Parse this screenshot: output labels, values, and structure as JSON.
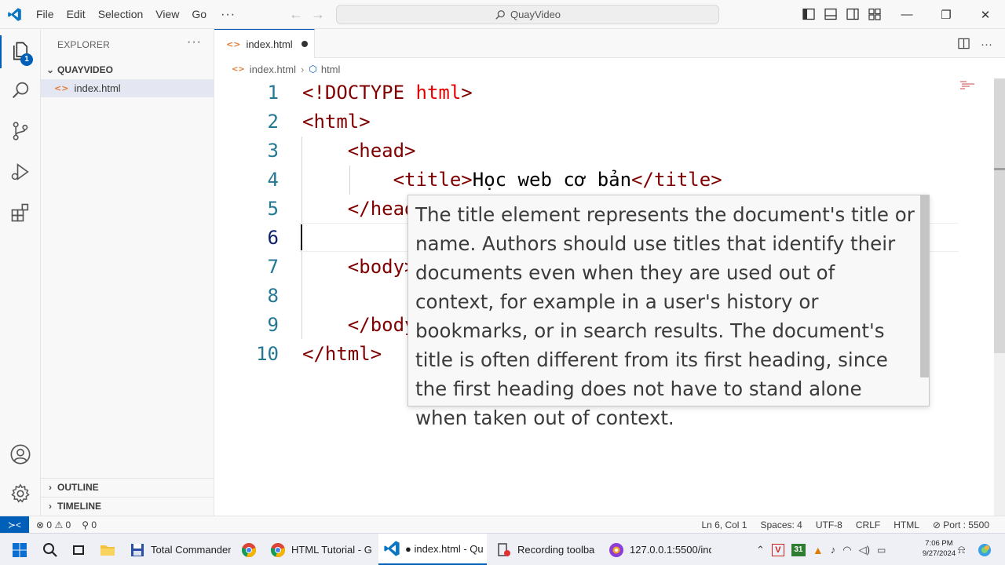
{
  "titlebar": {
    "menu": [
      "File",
      "Edit",
      "Selection",
      "View",
      "Go"
    ],
    "more": "···",
    "search": "QuayVideo",
    "window_controls": [
      "minimize-icon",
      "restore-icon",
      "close-icon"
    ]
  },
  "activity": {
    "explorer_badge": "1",
    "items": [
      "files-icon",
      "search-icon",
      "source-control-icon",
      "run-debug-icon",
      "extensions-icon",
      "account-icon",
      "settings-gear-icon"
    ]
  },
  "sidebar": {
    "title": "EXPLORER",
    "more": "···",
    "folder": "QUAYVIDEO",
    "file": "index.html",
    "outline": "OUTLINE",
    "timeline": "TIMELINE"
  },
  "tabs": [
    {
      "label": "index.html",
      "dirty": true
    }
  ],
  "breadcrumb": {
    "file": "index.html",
    "element": "html"
  },
  "editor": {
    "lines": [
      {
        "n": "1",
        "parts": [
          [
            "tag",
            "<!DOCTYPE "
          ],
          [
            "attr",
            "html"
          ],
          [
            "tag",
            ">"
          ]
        ]
      },
      {
        "n": "2",
        "parts": [
          [
            "tag",
            "<html>"
          ]
        ]
      },
      {
        "n": "3",
        "parts": [
          [
            "txt",
            "    "
          ],
          [
            "tag",
            "<head>"
          ]
        ]
      },
      {
        "n": "4",
        "parts": [
          [
            "txt",
            "        "
          ],
          [
            "tag",
            "<title>"
          ],
          [
            "txt",
            "Học web cơ bản"
          ],
          [
            "tag",
            "</title>"
          ]
        ]
      },
      {
        "n": "5",
        "parts": [
          [
            "txt",
            "    "
          ],
          [
            "tag",
            "</head>"
          ]
        ]
      },
      {
        "n": "6",
        "parts": []
      },
      {
        "n": "7",
        "parts": [
          [
            "txt",
            "    "
          ],
          [
            "tag",
            "<body>"
          ]
        ]
      },
      {
        "n": "8",
        "parts": []
      },
      {
        "n": "9",
        "parts": [
          [
            "txt",
            "    "
          ],
          [
            "tag",
            "</body>"
          ]
        ]
      },
      {
        "n": "10",
        "parts": [
          [
            "tag",
            "</html>"
          ]
        ]
      }
    ],
    "active_line": "6"
  },
  "hover": {
    "text": "The title element represents the document's title or name. Authors should use titles that identify their documents even when they are used out of context, for example in a user's history or bookmarks, or in search results. The document's title is often different from its first heading, since the first heading does not have to stand alone when taken out of context."
  },
  "statusbar": {
    "errors": "0",
    "warnings": "0",
    "ports": "0",
    "position": "Ln 6, Col 1",
    "spaces": "Spaces: 4",
    "encoding": "UTF-8",
    "eol": "CRLF",
    "language": "HTML",
    "port": "Port : 5500"
  },
  "taskbar": {
    "items": [
      {
        "label": "Total Commander"
      },
      {
        "label": "HTML Tutorial - G"
      },
      {
        "label": "● index.html - Qu"
      },
      {
        "label": "Recording toolba"
      },
      {
        "label": "127.0.0.1:5500/ind"
      }
    ],
    "calendar_badge": "31",
    "time": "7:06 PM",
    "date": "9/27/2024"
  },
  "colors": {
    "accent": "#005fb8",
    "tag": "#800000",
    "attr": "#e50000",
    "line_number": "#237893"
  }
}
